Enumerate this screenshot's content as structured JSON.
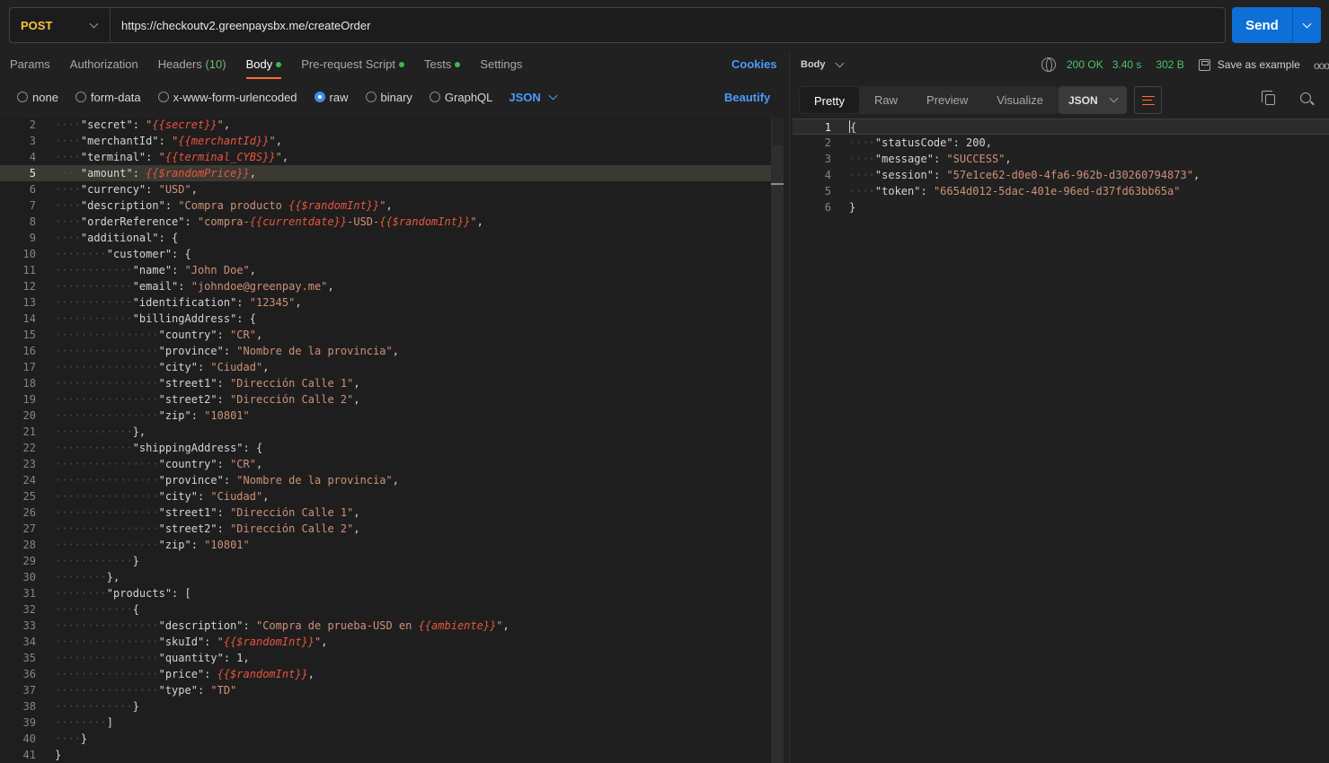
{
  "request": {
    "method": "POST",
    "url": "https://checkoutv2.greenpaysbx.me/createOrder",
    "send_label": "Send"
  },
  "request_tabs": {
    "params": "Params",
    "authorization": "Authorization",
    "headers": "Headers",
    "headers_count": "(10)",
    "body": "Body",
    "pre_request": "Pre-request Script",
    "tests": "Tests",
    "settings": "Settings",
    "cookies": "Cookies"
  },
  "body_types": {
    "none": "none",
    "form_data": "form-data",
    "urlencoded": "x-www-form-urlencoded",
    "raw": "raw",
    "binary": "binary",
    "graphql": "GraphQL",
    "language": "JSON",
    "beautify": "Beautify",
    "selected": "raw"
  },
  "request_editor": {
    "highlighted_line": 5,
    "lines": [
      {
        "n": "2",
        "i": 1,
        "segs": [
          [
            "k",
            "\"secret\""
          ],
          [
            "p",
            ": "
          ],
          [
            "s",
            "\""
          ],
          [
            "v",
            "{{secret}}"
          ],
          [
            "s",
            "\""
          ],
          [
            "p",
            ","
          ]
        ]
      },
      {
        "n": "3",
        "i": 1,
        "segs": [
          [
            "k",
            "\"merchantId\""
          ],
          [
            "p",
            ": "
          ],
          [
            "s",
            "\""
          ],
          [
            "v",
            "{{merchantId}}"
          ],
          [
            "s",
            "\""
          ],
          [
            "p",
            ","
          ]
        ]
      },
      {
        "n": "4",
        "i": 1,
        "segs": [
          [
            "k",
            "\"terminal\""
          ],
          [
            "p",
            ": "
          ],
          [
            "s",
            "\""
          ],
          [
            "v",
            "{{terminal_CYBS}}"
          ],
          [
            "s",
            "\""
          ],
          [
            "p",
            ","
          ]
        ]
      },
      {
        "n": "5",
        "i": 1,
        "segs": [
          [
            "k",
            "\"amount\""
          ],
          [
            "p",
            ": "
          ],
          [
            "v",
            "{{$randomPrice}}"
          ],
          [
            "p",
            ","
          ]
        ]
      },
      {
        "n": "6",
        "i": 1,
        "segs": [
          [
            "k",
            "\"currency\""
          ],
          [
            "p",
            ": "
          ],
          [
            "s",
            "\"USD\""
          ],
          [
            "p",
            ","
          ]
        ]
      },
      {
        "n": "7",
        "i": 1,
        "segs": [
          [
            "k",
            "\"description\""
          ],
          [
            "p",
            ": "
          ],
          [
            "s",
            "\"Compra producto "
          ],
          [
            "v",
            "{{$randomInt}}"
          ],
          [
            "s",
            "\""
          ],
          [
            "p",
            ","
          ]
        ]
      },
      {
        "n": "8",
        "i": 1,
        "segs": [
          [
            "k",
            "\"orderReference\""
          ],
          [
            "p",
            ": "
          ],
          [
            "s",
            "\"compra-"
          ],
          [
            "v",
            "{{currentdate}}"
          ],
          [
            "s",
            "-USD-"
          ],
          [
            "v",
            "{{$randomInt}}"
          ],
          [
            "s",
            "\""
          ],
          [
            "p",
            ","
          ]
        ]
      },
      {
        "n": "9",
        "i": 1,
        "segs": [
          [
            "k",
            "\"additional\""
          ],
          [
            "p",
            ": {"
          ]
        ]
      },
      {
        "n": "10",
        "i": 2,
        "segs": [
          [
            "k",
            "\"customer\""
          ],
          [
            "p",
            ": {"
          ]
        ]
      },
      {
        "n": "11",
        "i": 3,
        "segs": [
          [
            "k",
            "\"name\""
          ],
          [
            "p",
            ": "
          ],
          [
            "s",
            "\"John Doe\""
          ],
          [
            "p",
            ","
          ]
        ]
      },
      {
        "n": "12",
        "i": 3,
        "segs": [
          [
            "k",
            "\"email\""
          ],
          [
            "p",
            ": "
          ],
          [
            "s",
            "\"johndoe@greenpay.me\""
          ],
          [
            "p",
            ","
          ]
        ]
      },
      {
        "n": "13",
        "i": 3,
        "segs": [
          [
            "k",
            "\"identification\""
          ],
          [
            "p",
            ": "
          ],
          [
            "s",
            "\"12345\""
          ],
          [
            "p",
            ","
          ]
        ]
      },
      {
        "n": "14",
        "i": 3,
        "segs": [
          [
            "k",
            "\"billingAddress\""
          ],
          [
            "p",
            ": {"
          ]
        ]
      },
      {
        "n": "15",
        "i": 4,
        "segs": [
          [
            "k",
            "\"country\""
          ],
          [
            "p",
            ": "
          ],
          [
            "s",
            "\"CR\""
          ],
          [
            "p",
            ","
          ]
        ]
      },
      {
        "n": "16",
        "i": 4,
        "segs": [
          [
            "k",
            "\"province\""
          ],
          [
            "p",
            ": "
          ],
          [
            "s",
            "\"Nombre de la provincia\""
          ],
          [
            "p",
            ","
          ]
        ]
      },
      {
        "n": "17",
        "i": 4,
        "segs": [
          [
            "k",
            "\"city\""
          ],
          [
            "p",
            ": "
          ],
          [
            "s",
            "\"Ciudad\""
          ],
          [
            "p",
            ","
          ]
        ]
      },
      {
        "n": "18",
        "i": 4,
        "segs": [
          [
            "k",
            "\"street1\""
          ],
          [
            "p",
            ": "
          ],
          [
            "s",
            "\"Dirección Calle 1\""
          ],
          [
            "p",
            ","
          ]
        ]
      },
      {
        "n": "19",
        "i": 4,
        "segs": [
          [
            "k",
            "\"street2\""
          ],
          [
            "p",
            ": "
          ],
          [
            "s",
            "\"Dirección Calle 2\""
          ],
          [
            "p",
            ","
          ]
        ]
      },
      {
        "n": "20",
        "i": 4,
        "segs": [
          [
            "k",
            "\"zip\""
          ],
          [
            "p",
            ": "
          ],
          [
            "s",
            "\"10801\""
          ]
        ]
      },
      {
        "n": "21",
        "i": 3,
        "segs": [
          [
            "p",
            "},"
          ]
        ]
      },
      {
        "n": "22",
        "i": 3,
        "segs": [
          [
            "k",
            "\"shippingAddress\""
          ],
          [
            "p",
            ": {"
          ]
        ]
      },
      {
        "n": "23",
        "i": 4,
        "segs": [
          [
            "k",
            "\"country\""
          ],
          [
            "p",
            ": "
          ],
          [
            "s",
            "\"CR\""
          ],
          [
            "p",
            ","
          ]
        ]
      },
      {
        "n": "24",
        "i": 4,
        "segs": [
          [
            "k",
            "\"province\""
          ],
          [
            "p",
            ": "
          ],
          [
            "s",
            "\"Nombre de la provincia\""
          ],
          [
            "p",
            ","
          ]
        ]
      },
      {
        "n": "25",
        "i": 4,
        "segs": [
          [
            "k",
            "\"city\""
          ],
          [
            "p",
            ": "
          ],
          [
            "s",
            "\"Ciudad\""
          ],
          [
            "p",
            ","
          ]
        ]
      },
      {
        "n": "26",
        "i": 4,
        "segs": [
          [
            "k",
            "\"street1\""
          ],
          [
            "p",
            ": "
          ],
          [
            "s",
            "\"Dirección Calle 1\""
          ],
          [
            "p",
            ","
          ]
        ]
      },
      {
        "n": "27",
        "i": 4,
        "segs": [
          [
            "k",
            "\"street2\""
          ],
          [
            "p",
            ": "
          ],
          [
            "s",
            "\"Dirección Calle 2\""
          ],
          [
            "p",
            ","
          ]
        ]
      },
      {
        "n": "28",
        "i": 4,
        "segs": [
          [
            "k",
            "\"zip\""
          ],
          [
            "p",
            ": "
          ],
          [
            "s",
            "\"10801\""
          ]
        ]
      },
      {
        "n": "29",
        "i": 3,
        "segs": [
          [
            "p",
            "}"
          ]
        ]
      },
      {
        "n": "30",
        "i": 2,
        "segs": [
          [
            "p",
            "},"
          ]
        ]
      },
      {
        "n": "31",
        "i": 2,
        "segs": [
          [
            "k",
            "\"products\""
          ],
          [
            "p",
            ": ["
          ]
        ]
      },
      {
        "n": "32",
        "i": 3,
        "segs": [
          [
            "p",
            "{"
          ]
        ]
      },
      {
        "n": "33",
        "i": 4,
        "segs": [
          [
            "k",
            "\"description\""
          ],
          [
            "p",
            ": "
          ],
          [
            "s",
            "\"Compra de prueba-USD en "
          ],
          [
            "v",
            "{{ambiente}}"
          ],
          [
            "s",
            "\""
          ],
          [
            "p",
            ","
          ]
        ]
      },
      {
        "n": "34",
        "i": 4,
        "segs": [
          [
            "k",
            "\"skuId\""
          ],
          [
            "p",
            ": "
          ],
          [
            "s",
            "\""
          ],
          [
            "v",
            "{{$randomInt}}"
          ],
          [
            "s",
            "\""
          ],
          [
            "p",
            ","
          ]
        ]
      },
      {
        "n": "35",
        "i": 4,
        "segs": [
          [
            "k",
            "\"quantity\""
          ],
          [
            "p",
            ": 1,"
          ]
        ]
      },
      {
        "n": "36",
        "i": 4,
        "segs": [
          [
            "k",
            "\"price\""
          ],
          [
            "p",
            ": "
          ],
          [
            "v",
            "{{$randomInt}}"
          ],
          [
            "p",
            ","
          ]
        ]
      },
      {
        "n": "37",
        "i": 4,
        "segs": [
          [
            "k",
            "\"type\""
          ],
          [
            "p",
            ": "
          ],
          [
            "s",
            "\"TD\""
          ]
        ]
      },
      {
        "n": "38",
        "i": 3,
        "segs": [
          [
            "p",
            "}"
          ]
        ]
      },
      {
        "n": "39",
        "i": 2,
        "segs": [
          [
            "p",
            "]"
          ]
        ]
      },
      {
        "n": "40",
        "i": 1,
        "segs": [
          [
            "p",
            "}"
          ]
        ]
      },
      {
        "n": "41",
        "i": 0,
        "segs": [
          [
            "p",
            "}"
          ]
        ]
      }
    ]
  },
  "response": {
    "body_label": "Body",
    "status": "200 OK",
    "time": "3.40 s",
    "size": "302 B",
    "save_example": "Save as example",
    "tabs": [
      "Pretty",
      "Raw",
      "Preview",
      "Visualize"
    ],
    "active_tab": "Pretty",
    "format": "JSON",
    "lines": [
      {
        "n": "1",
        "i": 0,
        "segs": [
          [
            "p",
            "{"
          ]
        ]
      },
      {
        "n": "2",
        "i": 1,
        "segs": [
          [
            "k",
            "\"statusCode\""
          ],
          [
            "p",
            ": 200,"
          ]
        ]
      },
      {
        "n": "3",
        "i": 1,
        "segs": [
          [
            "k",
            "\"message\""
          ],
          [
            "p",
            ": "
          ],
          [
            "s",
            "\"SUCCESS\""
          ],
          [
            "p",
            ","
          ]
        ]
      },
      {
        "n": "4",
        "i": 1,
        "segs": [
          [
            "k",
            "\"session\""
          ],
          [
            "p",
            ": "
          ],
          [
            "s",
            "\"57e1ce62-d0e0-4fa6-962b-d30260794873\""
          ],
          [
            "p",
            ","
          ]
        ]
      },
      {
        "n": "5",
        "i": 1,
        "segs": [
          [
            "k",
            "\"token\""
          ],
          [
            "p",
            ": "
          ],
          [
            "s",
            "\"6654d012-5dac-401e-96ed-d37fd63bb65a\""
          ]
        ]
      },
      {
        "n": "6",
        "i": 0,
        "segs": [
          [
            "p",
            "}"
          ]
        ]
      }
    ]
  },
  "icons": {
    "method_dropdown": "chevron-down-icon",
    "send_dropdown": "chevron-down-icon",
    "network": "globe-icon",
    "save": "save-icon",
    "more": "more-options-icon",
    "wrap": "wrap-lines-icon",
    "copy": "copy-icon",
    "search": "search-icon"
  },
  "colors": {
    "accent": "#ff6c37",
    "send_button": "#0e6fd6",
    "method_post": "#f5c342",
    "status_ok": "#4bc46a",
    "link": "#4c9bff",
    "variable": "#e8553f",
    "string": "#ce9178"
  }
}
